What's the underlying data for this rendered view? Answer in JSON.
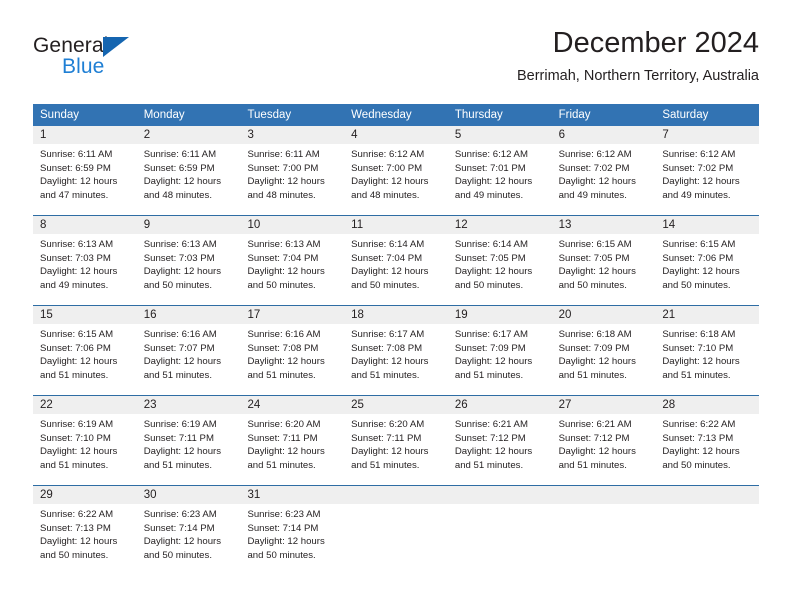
{
  "brand": {
    "name_dark": "General",
    "name_blue": "Blue",
    "logo_triangle_color": "#1565b0",
    "blue_text_color": "#1f7fd4"
  },
  "header": {
    "title": "December 2024",
    "subtitle": "Berrimah, Northern Territory, Australia"
  },
  "colors": {
    "header_row_background": "#3273b3",
    "header_row_text": "#ffffff",
    "date_strip_background": "#efefef",
    "week_separator": "#2e6da4",
    "body_text": "#231f20",
    "cell_background": "#ffffff"
  },
  "calendar": {
    "weekdays": [
      "Sunday",
      "Monday",
      "Tuesday",
      "Wednesday",
      "Thursday",
      "Friday",
      "Saturday"
    ],
    "weeks": [
      [
        {
          "date": "1",
          "sunrise": "Sunrise: 6:11 AM",
          "sunset": "Sunset: 6:59 PM",
          "daylight_line1": "Daylight: 12 hours",
          "daylight_line2": "and 47 minutes."
        },
        {
          "date": "2",
          "sunrise": "Sunrise: 6:11 AM",
          "sunset": "Sunset: 6:59 PM",
          "daylight_line1": "Daylight: 12 hours",
          "daylight_line2": "and 48 minutes."
        },
        {
          "date": "3",
          "sunrise": "Sunrise: 6:11 AM",
          "sunset": "Sunset: 7:00 PM",
          "daylight_line1": "Daylight: 12 hours",
          "daylight_line2": "and 48 minutes."
        },
        {
          "date": "4",
          "sunrise": "Sunrise: 6:12 AM",
          "sunset": "Sunset: 7:00 PM",
          "daylight_line1": "Daylight: 12 hours",
          "daylight_line2": "and 48 minutes."
        },
        {
          "date": "5",
          "sunrise": "Sunrise: 6:12 AM",
          "sunset": "Sunset: 7:01 PM",
          "daylight_line1": "Daylight: 12 hours",
          "daylight_line2": "and 49 minutes."
        },
        {
          "date": "6",
          "sunrise": "Sunrise: 6:12 AM",
          "sunset": "Sunset: 7:02 PM",
          "daylight_line1": "Daylight: 12 hours",
          "daylight_line2": "and 49 minutes."
        },
        {
          "date": "7",
          "sunrise": "Sunrise: 6:12 AM",
          "sunset": "Sunset: 7:02 PM",
          "daylight_line1": "Daylight: 12 hours",
          "daylight_line2": "and 49 minutes."
        }
      ],
      [
        {
          "date": "8",
          "sunrise": "Sunrise: 6:13 AM",
          "sunset": "Sunset: 7:03 PM",
          "daylight_line1": "Daylight: 12 hours",
          "daylight_line2": "and 49 minutes."
        },
        {
          "date": "9",
          "sunrise": "Sunrise: 6:13 AM",
          "sunset": "Sunset: 7:03 PM",
          "daylight_line1": "Daylight: 12 hours",
          "daylight_line2": "and 50 minutes."
        },
        {
          "date": "10",
          "sunrise": "Sunrise: 6:13 AM",
          "sunset": "Sunset: 7:04 PM",
          "daylight_line1": "Daylight: 12 hours",
          "daylight_line2": "and 50 minutes."
        },
        {
          "date": "11",
          "sunrise": "Sunrise: 6:14 AM",
          "sunset": "Sunset: 7:04 PM",
          "daylight_line1": "Daylight: 12 hours",
          "daylight_line2": "and 50 minutes."
        },
        {
          "date": "12",
          "sunrise": "Sunrise: 6:14 AM",
          "sunset": "Sunset: 7:05 PM",
          "daylight_line1": "Daylight: 12 hours",
          "daylight_line2": "and 50 minutes."
        },
        {
          "date": "13",
          "sunrise": "Sunrise: 6:15 AM",
          "sunset": "Sunset: 7:05 PM",
          "daylight_line1": "Daylight: 12 hours",
          "daylight_line2": "and 50 minutes."
        },
        {
          "date": "14",
          "sunrise": "Sunrise: 6:15 AM",
          "sunset": "Sunset: 7:06 PM",
          "daylight_line1": "Daylight: 12 hours",
          "daylight_line2": "and 50 minutes."
        }
      ],
      [
        {
          "date": "15",
          "sunrise": "Sunrise: 6:15 AM",
          "sunset": "Sunset: 7:06 PM",
          "daylight_line1": "Daylight: 12 hours",
          "daylight_line2": "and 51 minutes."
        },
        {
          "date": "16",
          "sunrise": "Sunrise: 6:16 AM",
          "sunset": "Sunset: 7:07 PM",
          "daylight_line1": "Daylight: 12 hours",
          "daylight_line2": "and 51 minutes."
        },
        {
          "date": "17",
          "sunrise": "Sunrise: 6:16 AM",
          "sunset": "Sunset: 7:08 PM",
          "daylight_line1": "Daylight: 12 hours",
          "daylight_line2": "and 51 minutes."
        },
        {
          "date": "18",
          "sunrise": "Sunrise: 6:17 AM",
          "sunset": "Sunset: 7:08 PM",
          "daylight_line1": "Daylight: 12 hours",
          "daylight_line2": "and 51 minutes."
        },
        {
          "date": "19",
          "sunrise": "Sunrise: 6:17 AM",
          "sunset": "Sunset: 7:09 PM",
          "daylight_line1": "Daylight: 12 hours",
          "daylight_line2": "and 51 minutes."
        },
        {
          "date": "20",
          "sunrise": "Sunrise: 6:18 AM",
          "sunset": "Sunset: 7:09 PM",
          "daylight_line1": "Daylight: 12 hours",
          "daylight_line2": "and 51 minutes."
        },
        {
          "date": "21",
          "sunrise": "Sunrise: 6:18 AM",
          "sunset": "Sunset: 7:10 PM",
          "daylight_line1": "Daylight: 12 hours",
          "daylight_line2": "and 51 minutes."
        }
      ],
      [
        {
          "date": "22",
          "sunrise": "Sunrise: 6:19 AM",
          "sunset": "Sunset: 7:10 PM",
          "daylight_line1": "Daylight: 12 hours",
          "daylight_line2": "and 51 minutes."
        },
        {
          "date": "23",
          "sunrise": "Sunrise: 6:19 AM",
          "sunset": "Sunset: 7:11 PM",
          "daylight_line1": "Daylight: 12 hours",
          "daylight_line2": "and 51 minutes."
        },
        {
          "date": "24",
          "sunrise": "Sunrise: 6:20 AM",
          "sunset": "Sunset: 7:11 PM",
          "daylight_line1": "Daylight: 12 hours",
          "daylight_line2": "and 51 minutes."
        },
        {
          "date": "25",
          "sunrise": "Sunrise: 6:20 AM",
          "sunset": "Sunset: 7:11 PM",
          "daylight_line1": "Daylight: 12 hours",
          "daylight_line2": "and 51 minutes."
        },
        {
          "date": "26",
          "sunrise": "Sunrise: 6:21 AM",
          "sunset": "Sunset: 7:12 PM",
          "daylight_line1": "Daylight: 12 hours",
          "daylight_line2": "and 51 minutes."
        },
        {
          "date": "27",
          "sunrise": "Sunrise: 6:21 AM",
          "sunset": "Sunset: 7:12 PM",
          "daylight_line1": "Daylight: 12 hours",
          "daylight_line2": "and 51 minutes."
        },
        {
          "date": "28",
          "sunrise": "Sunrise: 6:22 AM",
          "sunset": "Sunset: 7:13 PM",
          "daylight_line1": "Daylight: 12 hours",
          "daylight_line2": "and 50 minutes."
        }
      ],
      [
        {
          "date": "29",
          "sunrise": "Sunrise: 6:22 AM",
          "sunset": "Sunset: 7:13 PM",
          "daylight_line1": "Daylight: 12 hours",
          "daylight_line2": "and 50 minutes."
        },
        {
          "date": "30",
          "sunrise": "Sunrise: 6:23 AM",
          "sunset": "Sunset: 7:14 PM",
          "daylight_line1": "Daylight: 12 hours",
          "daylight_line2": "and 50 minutes."
        },
        {
          "date": "31",
          "sunrise": "Sunrise: 6:23 AM",
          "sunset": "Sunset: 7:14 PM",
          "daylight_line1": "Daylight: 12 hours",
          "daylight_line2": "and 50 minutes."
        },
        {
          "date": "",
          "sunrise": "",
          "sunset": "",
          "daylight_line1": "",
          "daylight_line2": ""
        },
        {
          "date": "",
          "sunrise": "",
          "sunset": "",
          "daylight_line1": "",
          "daylight_line2": ""
        },
        {
          "date": "",
          "sunrise": "",
          "sunset": "",
          "daylight_line1": "",
          "daylight_line2": ""
        },
        {
          "date": "",
          "sunrise": "",
          "sunset": "",
          "daylight_line1": "",
          "daylight_line2": ""
        }
      ]
    ]
  }
}
